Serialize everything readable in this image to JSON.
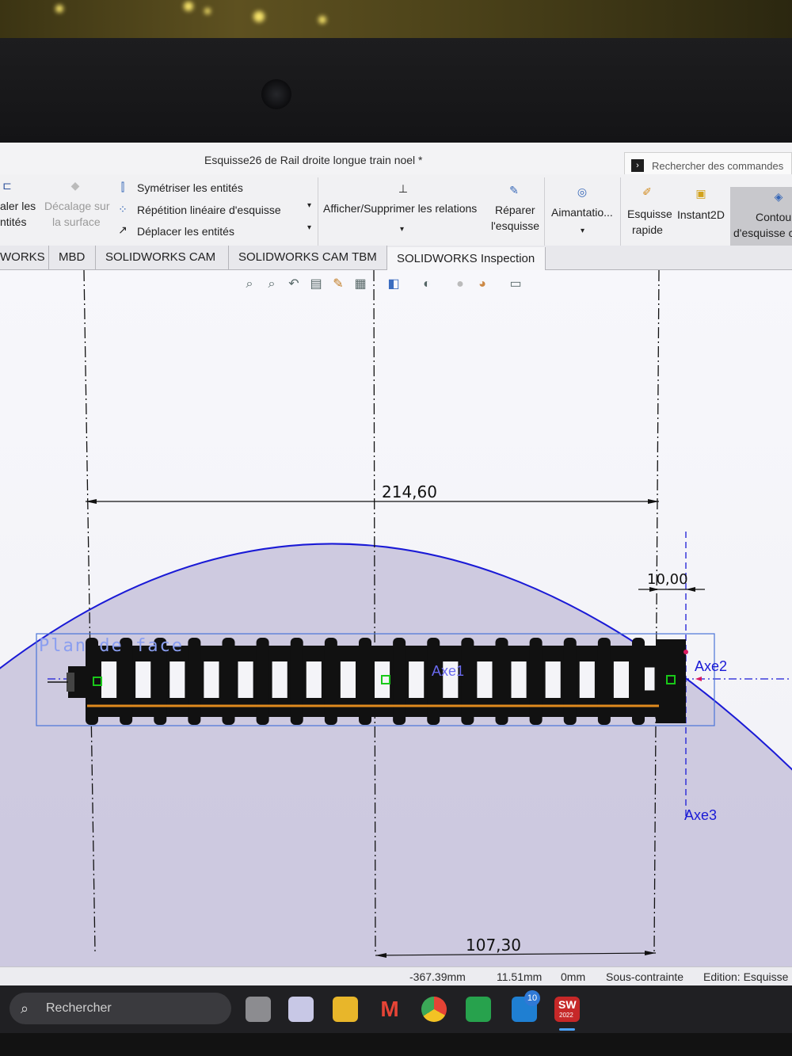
{
  "window": {
    "title": "Esquisse26 de Rail droite longue train noel *",
    "command_search_placeholder": "Rechercher des commandes"
  },
  "ribbon": {
    "partial_left_line1": "aler les",
    "partial_left_line2": "ntités",
    "offset_surface_line1": "Décalage sur",
    "offset_surface_line2": "la surface",
    "mirror_entities": "Symétriser les entités",
    "linear_pattern": "Répétition linéaire d'esquisse",
    "move_entities": "Déplacer les entités",
    "display_relations": "Afficher/Supprimer les relations",
    "repair_sketch_line1": "Réparer",
    "repair_sketch_line2": "l'esquisse",
    "magnetic": "Aimantatio...",
    "rapid_sketch_line1": "Esquisse",
    "rapid_sketch_line2": "rapide",
    "instant2d": "Instant2D",
    "sketch_contour_line1": "Contou",
    "sketch_contour_line2": "d'esquisse c"
  },
  "tabs": [
    {
      "label": "WORKS"
    },
    {
      "label": "MBD"
    },
    {
      "label": "SOLIDWORKS CAM"
    },
    {
      "label": "SOLIDWORKS CAM TBM"
    },
    {
      "label": "SOLIDWORKS Inspection"
    }
  ],
  "sketch": {
    "dim_total": "214,60",
    "dim_offset": "10,00",
    "dim_half": "107,30",
    "plane_label": "Plan de face",
    "axis1": "Axe1",
    "axis2": "Axe2",
    "axis3": "Axe3",
    "sleeper_count": 17
  },
  "status": {
    "x": "-367.39mm",
    "y": "11.51mm",
    "z": "0mm",
    "constraint": "Sous-contrainte",
    "mode": "Edition: Esquisse"
  },
  "taskbar": {
    "search_label": "Rechercher",
    "badge_count": "10",
    "sw_label": "SW",
    "sw_year": "2022"
  },
  "colors": {
    "sketch_blue": "#1a1ad6",
    "sketch_black": "#111111",
    "rail_orange": "#e08a1e",
    "fixed_green": "#19c819",
    "plane_outline": "#4a74d8"
  }
}
